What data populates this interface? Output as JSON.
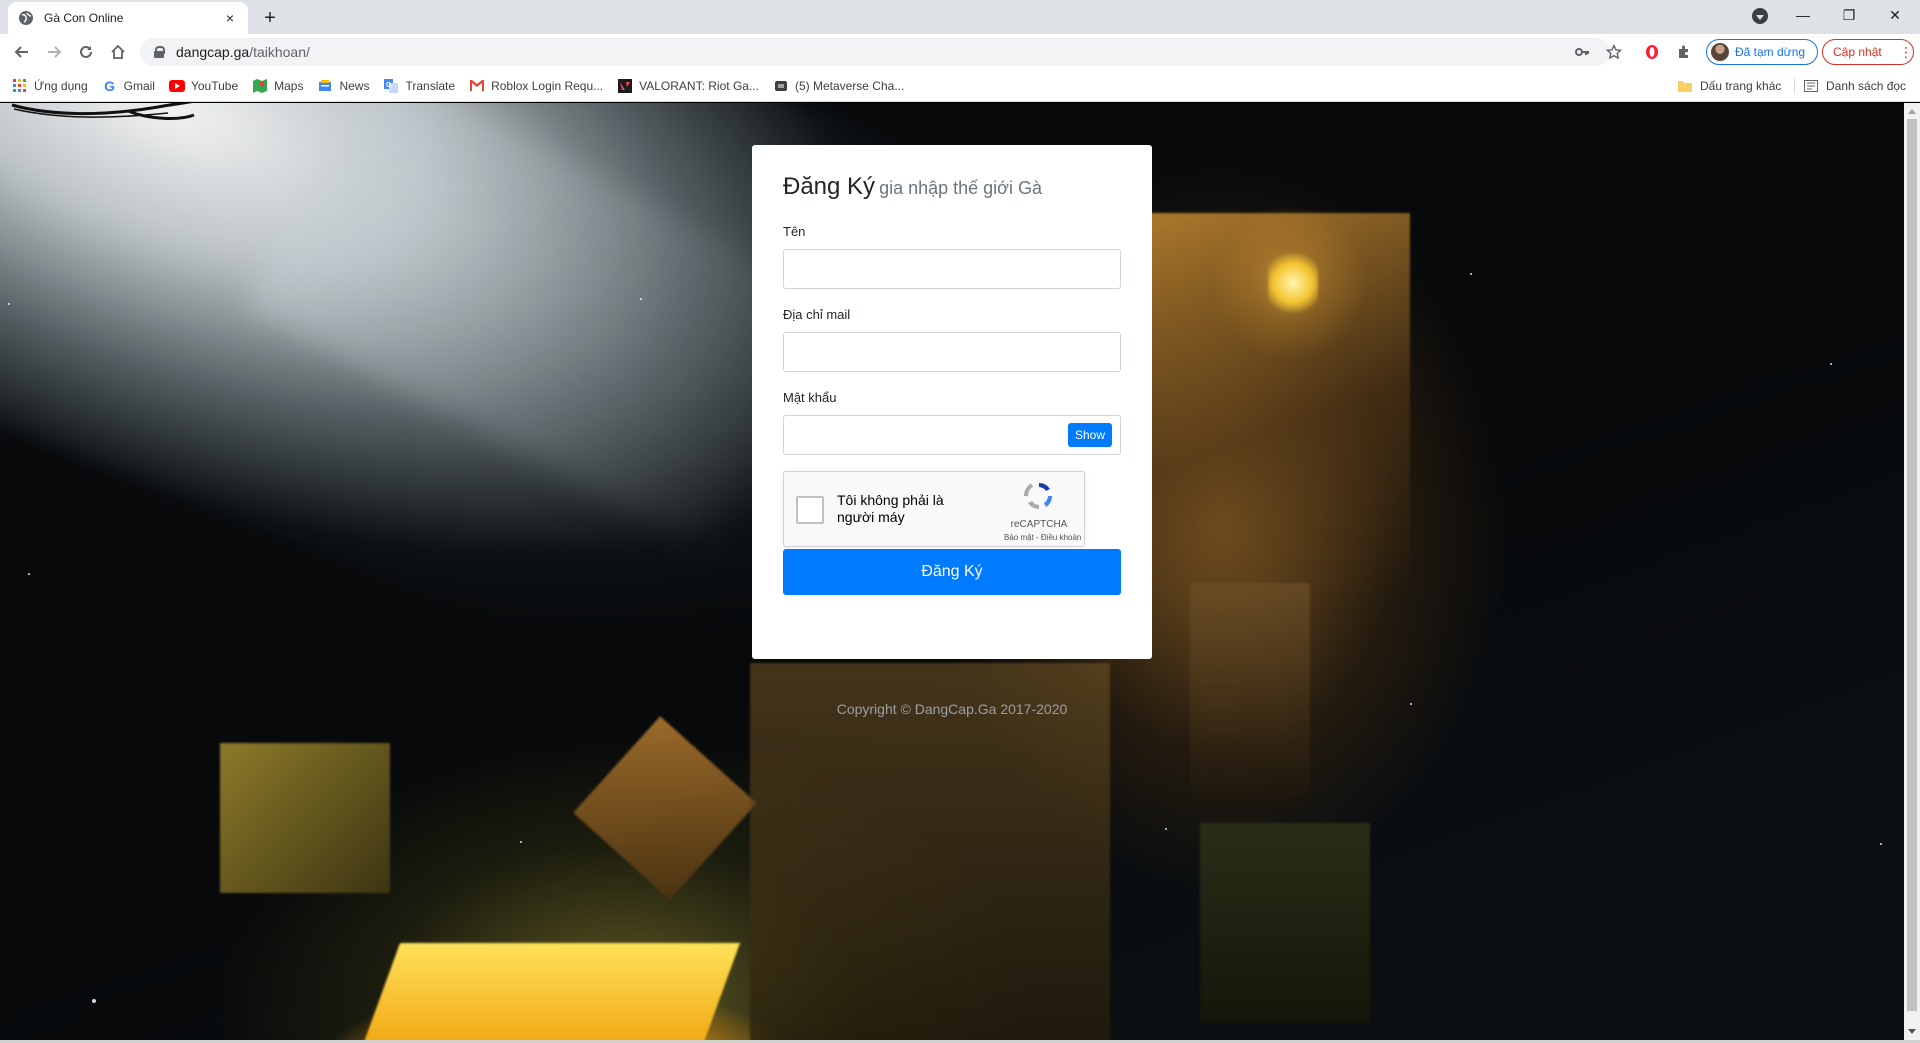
{
  "browser": {
    "tab": {
      "title": "Gà Con Online",
      "close_icon": "×"
    },
    "new_tab_icon": "+",
    "window": {
      "minimize": "—",
      "restore": "❐",
      "close": "✕"
    },
    "url": {
      "host": "dangcap.ga",
      "path": "/taikhoan/"
    },
    "profile": {
      "label": "Đã tạm dừng"
    },
    "update": {
      "label": "Cập nhật",
      "menu_icon": "⋮"
    },
    "bookmarks": [
      {
        "icon": "apps-icon",
        "label": "Ứng dụng"
      },
      {
        "icon": "google-icon",
        "label": "Gmail"
      },
      {
        "icon": "youtube-icon",
        "label": "YouTube"
      },
      {
        "icon": "maps-icon",
        "label": "Maps"
      },
      {
        "icon": "news-icon",
        "label": "News"
      },
      {
        "icon": "translate-icon",
        "label": "Translate"
      },
      {
        "icon": "gmail-icon",
        "label": "Roblox Login Requ..."
      },
      {
        "icon": "valorant-icon",
        "label": "VALORANT: Riot Ga..."
      },
      {
        "icon": "page-icon",
        "label": "(5) Metaverse Cha..."
      }
    ],
    "other_bookmarks": "Dấu trang khác",
    "reading_list": "Danh sách đọc"
  },
  "form": {
    "title": "Đăng Ký",
    "subtitle": "gia nhập thế giới Gà",
    "name_label": "Tên",
    "email_label": "Địa chỉ mail",
    "password_label": "Mật khẩu",
    "show_label": "Show",
    "captcha_text": "Tôi không phải là người máy",
    "captcha_brand": "reCAPTCHA",
    "captcha_terms": "Bảo mật - Điều khoản",
    "submit_label": "Đăng Ký"
  },
  "footer": {
    "copyright": "Copyright © DangCap.Ga 2017-2020"
  },
  "colors": {
    "primary": "#007bff",
    "chrome_accent": "#1a73e8",
    "update_red": "#d93025"
  }
}
